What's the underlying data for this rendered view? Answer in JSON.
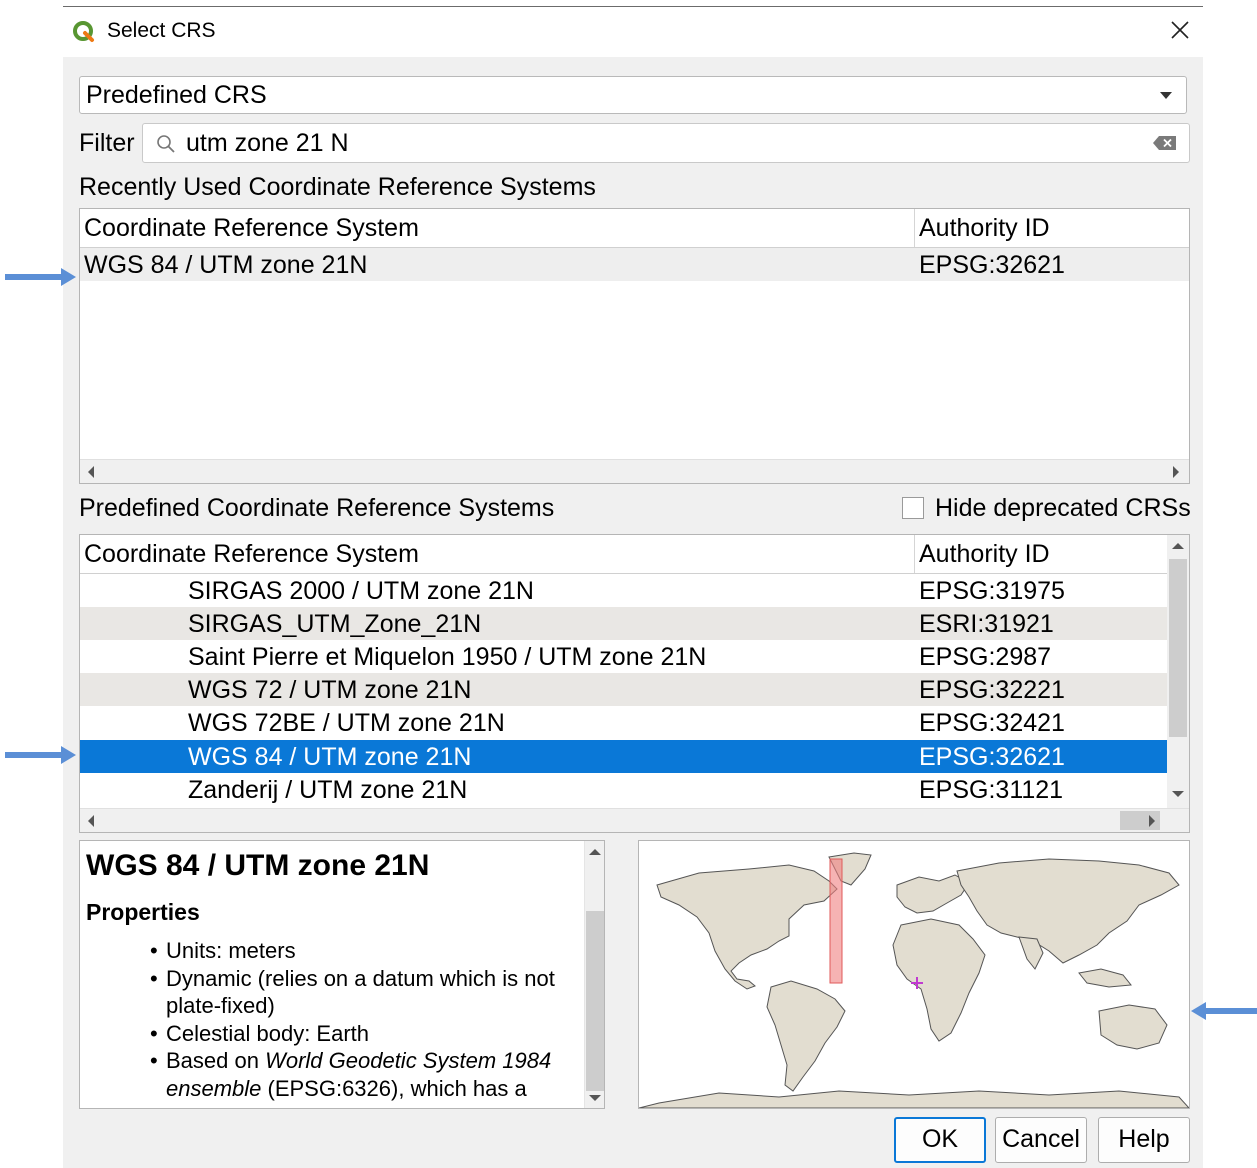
{
  "window": {
    "title": "Select CRS"
  },
  "combo": {
    "value": "Predefined CRS"
  },
  "filter": {
    "label": "Filter",
    "value": "utm zone 21 N"
  },
  "recent": {
    "label": "Recently Used Coordinate Reference Systems",
    "columns": [
      "Coordinate Reference System",
      "Authority ID"
    ],
    "rows": [
      {
        "name": "WGS 84 / UTM zone 21N",
        "id": "EPSG:32621"
      }
    ]
  },
  "predefined": {
    "label": "Predefined Coordinate Reference Systems",
    "hide_deprecated_label": "Hide deprecated CRSs",
    "columns": [
      "Coordinate Reference System",
      "Authority ID"
    ],
    "rows": [
      {
        "name": "SIRGAS 2000 / UTM zone 21N",
        "id": "EPSG:31975"
      },
      {
        "name": "SIRGAS_UTM_Zone_21N",
        "id": "ESRI:31921"
      },
      {
        "name": "Saint Pierre et Miquelon 1950 / UTM zone 21N",
        "id": "EPSG:2987"
      },
      {
        "name": "WGS 72 / UTM zone 21N",
        "id": "EPSG:32221"
      },
      {
        "name": "WGS 72BE / UTM zone 21N",
        "id": "EPSG:32421"
      },
      {
        "name": "WGS 84 / UTM zone 21N",
        "id": "EPSG:32621",
        "selected": true
      },
      {
        "name": "Zanderij / UTM zone 21N",
        "id": "EPSG:31121"
      }
    ]
  },
  "details": {
    "title": "WGS 84 / UTM zone 21N",
    "properties_heading": "Properties",
    "items": {
      "units": "Units: meters",
      "dynamic": "Dynamic (relies on a datum which is not plate-fixed)",
      "body": "Celestial body: Earth",
      "based_on_prefix": "Based on ",
      "based_on_italic": "World Geodetic System 1984 ensemble",
      "based_on_suffix": " (EPSG:6326), which has a"
    }
  },
  "buttons": {
    "ok": "OK",
    "cancel": "Cancel",
    "help": "Help"
  },
  "colors": {
    "selection": "#0a78d7",
    "annotation_arrow": "#5b8fd6",
    "crs_extent": "#f08080"
  },
  "icons": [
    "qgis-logo-icon",
    "close-icon",
    "chevron-down-icon",
    "search-icon",
    "clear-icon",
    "annotation-arrow"
  ]
}
